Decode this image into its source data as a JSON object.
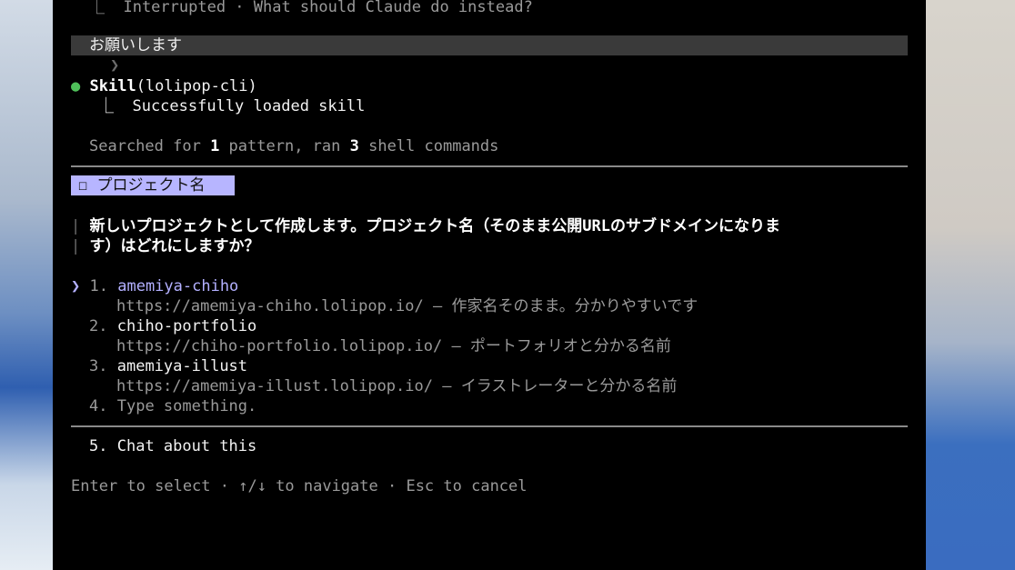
{
  "history": {
    "interrupted_line": "⎿  Interrupted · What should Claude do instead?",
    "user_prompt_chevron": "❯",
    "user_prompt": "お願いします",
    "skill_dot": "●",
    "skill_name": "Skill",
    "skill_arg": "(lolipop-cli)",
    "skill_result": "⎿  Successfully loaded skill",
    "search_prefix": "Searched for ",
    "search_count": "1",
    "search_mid": " pattern, ran ",
    "shell_count": "3",
    "search_suffix": " shell commands"
  },
  "question": {
    "tag": "☐ プロジェクト名",
    "bar": "|",
    "line1": "新しいプロジェクトとして作成します。プロジェクト名（そのまま公開URLのサブドメインになりま",
    "line2": "す）はどれにしますか？"
  },
  "options": {
    "cursor": "❯",
    "items": [
      {
        "num": "1.",
        "label": "amemiya-chiho",
        "desc": "https://amemiya-chiho.lolipop.io/ — 作家名そのまま。分かりやすいです"
      },
      {
        "num": "2.",
        "label": "chiho-portfolio",
        "desc": "https://chiho-portfolio.lolipop.io/ — ポートフォリオと分かる名前"
      },
      {
        "num": "3.",
        "label": "amemiya-illust",
        "desc": "https://amemiya-illust.lolipop.io/ — イラストレーターと分かる名前"
      },
      {
        "num": "4.",
        "label": "Type something."
      }
    ],
    "chat": {
      "num": "5.",
      "label": "Chat about this"
    }
  },
  "footer": {
    "hint": "Enter to select · ↑/↓ to navigate · Esc to cancel"
  }
}
